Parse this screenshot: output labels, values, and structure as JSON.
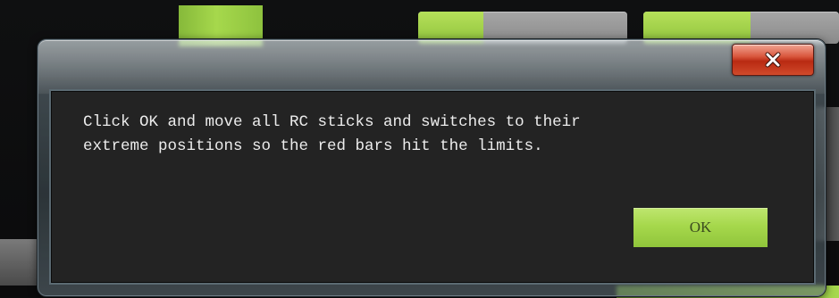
{
  "dialog": {
    "message_lines": [
      "Click OK and move all RC sticks and switches to their",
      "extreme positions so the red bars hit the limits."
    ],
    "ok_label": "OK",
    "close_icon": "close-icon"
  },
  "colors": {
    "accent_green": "#a6d84c",
    "close_red": "#c83a20",
    "panel_bg": "#232323",
    "text": "#ececec"
  }
}
